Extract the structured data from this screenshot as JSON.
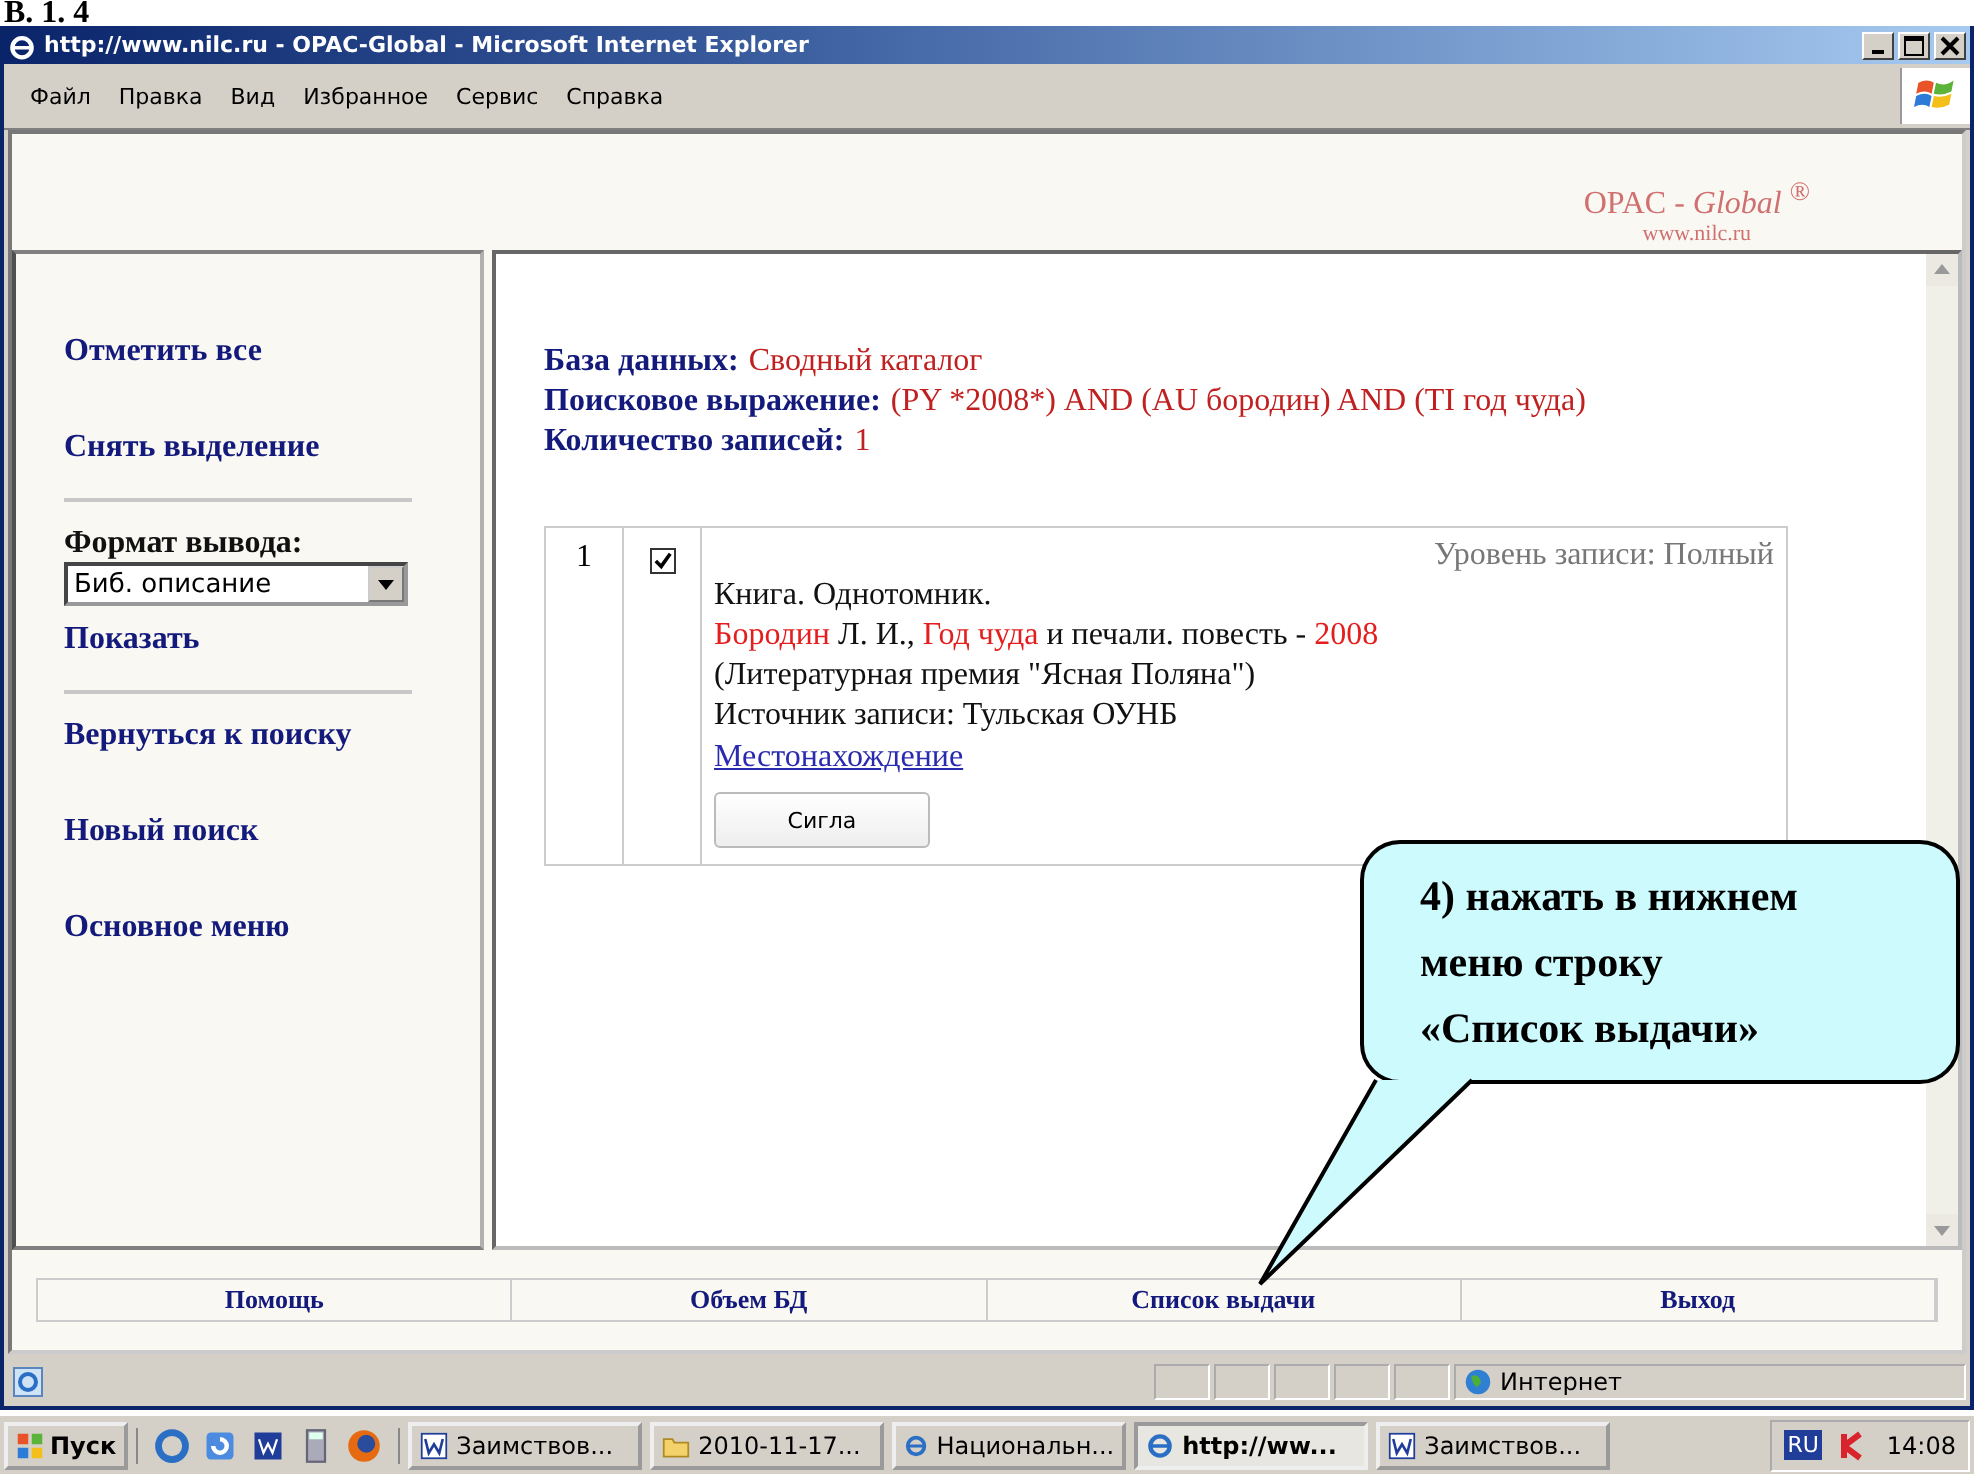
{
  "heading": "В. 1. 4",
  "window": {
    "title": "http://www.nilc.ru - OPAC-Global - Microsoft Internet Explorer"
  },
  "menu": [
    "Файл",
    "Правка",
    "Вид",
    "Избранное",
    "Сервис",
    "Справка"
  ],
  "banner": {
    "brand": "OPAC - *Global* $^{®}$",
    "url": "www.nilc.ru"
  },
  "sidebar": {
    "items": [
      {
        "kind": "link",
        "label": "Отметить все"
      },
      {
        "kind": "link",
        "label": "Снять выделение"
      },
      {
        "kind": "divider"
      },
      {
        "kind": "format",
        "label": "Формат вывода:",
        "value": "Биб. описание"
      },
      {
        "kind": "link",
        "label": "Показать"
      },
      {
        "kind": "divider"
      },
      {
        "kind": "link",
        "label": "Вернуться к поиску"
      },
      {
        "kind": "link",
        "label": "Новый поиск"
      },
      {
        "kind": "link",
        "label": "Основное меню"
      }
    ]
  },
  "query": [
    {
      "label": "База данных:",
      "value": "Сводный каталог"
    },
    {
      "label": "Поисковое выражение:",
      "value": "(PY *2008*) AND (AU бородин) AND (TI год чуда)"
    },
    {
      "label": "Количество записей:",
      "value": "1"
    }
  ],
  "records": [
    {
      "number": "1",
      "checked": true,
      "level_text": "Уровень записи: Полный",
      "lines": [
        [
          {
            "text": "Книга. Однотомник.",
            "highlight": false
          }
        ],
        [
          {
            "text": "Бородин",
            "highlight": true
          },
          {
            "text": " Л. И., ",
            "highlight": false
          },
          {
            "text": "Год чуда",
            "highlight": true
          },
          {
            "text": " и печали. повесть - ",
            "highlight": false
          },
          {
            "text": "2008",
            "highlight": true
          }
        ],
        [
          {
            "text": "(Литературная премия \"Ясная Поляна\")",
            "highlight": false
          }
        ],
        [
          {
            "text": "Источник записи: Тульская ОУНБ",
            "highlight": false
          }
        ]
      ],
      "link": "Местонахождение",
      "button": "Сигла"
    }
  ],
  "footer_nav": [
    "Помощь",
    "Объем БД",
    "Список выдачи",
    "Выход"
  ],
  "status_bar": {
    "zone": "Интернет"
  },
  "taskbar": {
    "start": "Пуск",
    "tasks": [
      {
        "kind": "word",
        "label": "Заимствов...",
        "selected": false
      },
      {
        "kind": "folder",
        "label": "2010-11-17...",
        "selected": false
      },
      {
        "kind": "ie",
        "label": "Национальн...",
        "selected": false
      },
      {
        "kind": "ie",
        "label": "http://ww...",
        "selected": true
      },
      {
        "kind": "word",
        "label": "Заимствов...",
        "selected": false
      }
    ],
    "lang": "RU",
    "time": "14:08"
  },
  "callout": {
    "lines": [
      "4) нажать в нижнем",
      "меню строку",
      "«Список выдачи»"
    ]
  }
}
